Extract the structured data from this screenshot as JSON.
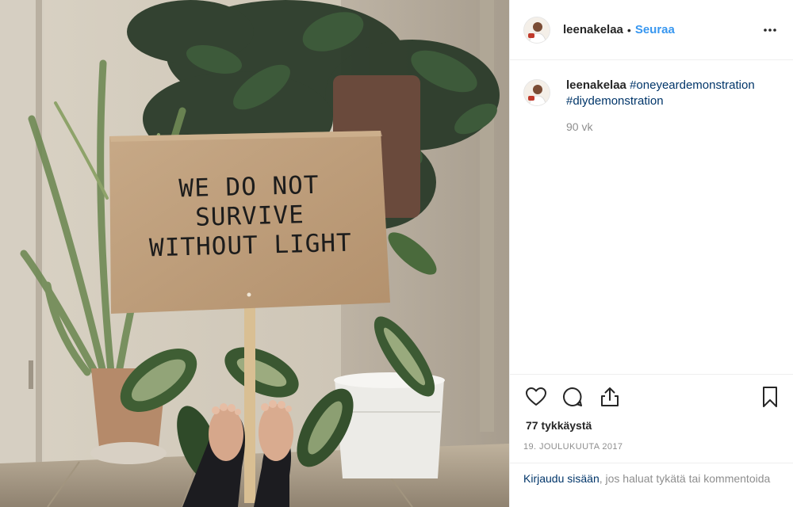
{
  "post": {
    "username": "leenakelaa",
    "separator": "•",
    "follow_label": "Seuraa",
    "caption": {
      "username": "leenakelaa",
      "hashtags": [
        "#oneyeardemonstration",
        "#diydemonstration"
      ]
    },
    "time_ago": "90 vk",
    "likes": "77 tykkäystä",
    "date": "19. JOULUKUUTA 2017",
    "login_prompt": {
      "link": "Kirjaudu sisään",
      "rest": ", jos haluat tykätä tai kommentoida"
    }
  },
  "photo": {
    "sign_lines": [
      "WE DO NOT",
      "SURVIVE",
      "WITHOUT LIGHT"
    ]
  },
  "icons": {
    "more": "more-horizontal-icon",
    "like": "heart-icon",
    "comment": "comment-bubble-icon",
    "share": "share-upload-icon",
    "save": "bookmark-icon"
  },
  "colors": {
    "link_blue": "#3897f0",
    "hashtag_navy": "#003569",
    "muted_gray": "#8e8e8e",
    "text": "#262626"
  }
}
